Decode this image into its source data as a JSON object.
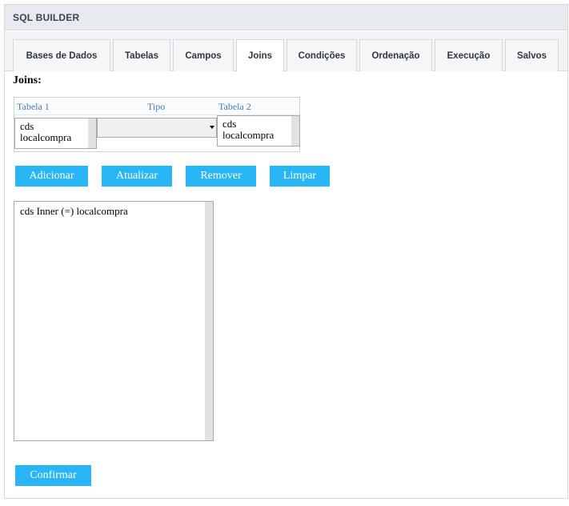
{
  "window": {
    "title": "SQL BUILDER"
  },
  "tabs": [
    {
      "label": "Bases de Dados"
    },
    {
      "label": "Tabelas"
    },
    {
      "label": "Campos"
    },
    {
      "label": "Joins",
      "active": true
    },
    {
      "label": "Condições"
    },
    {
      "label": "Ordenação"
    },
    {
      "label": "Execução"
    },
    {
      "label": "Salvos"
    }
  ],
  "joins": {
    "section_label": "Joins:",
    "columns": {
      "table1": "Tabela 1",
      "type": "Tipo",
      "table2": "Tabela 2"
    },
    "table1_items": [
      "cds",
      "localcompra"
    ],
    "type_selected": "",
    "table2_items": [
      "cds",
      "localcompra"
    ]
  },
  "actions": {
    "add": "Adicionar",
    "update": "Atualizar",
    "remove": "Remover",
    "clear": "Limpar"
  },
  "result_list": [
    "cds Inner (=) localcompra"
  ],
  "confirm": "Confirmar",
  "colors": {
    "accent": "#29b6f6",
    "header_bg": "#e7ebf0",
    "column_head": "#4a7ab0"
  }
}
